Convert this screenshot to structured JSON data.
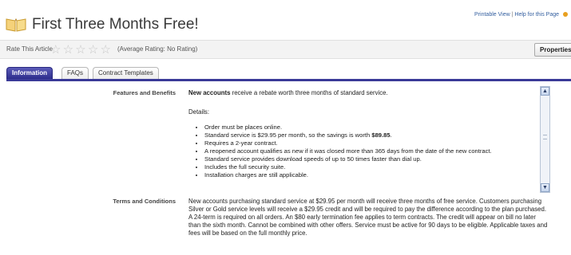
{
  "page": {
    "title": "First Three Months Free!",
    "links": {
      "printable": "Printable View",
      "separator": "|",
      "help": "Help for this Page"
    }
  },
  "rating": {
    "label": "Rate This Article",
    "stars": [
      "☆",
      "☆",
      "☆",
      "☆",
      "☆"
    ],
    "average_text": "(Average Rating: No Rating)",
    "properties_button": "Properties"
  },
  "tabs": [
    {
      "label": "Information",
      "active": true
    },
    {
      "label": "FAQs",
      "active": false
    },
    {
      "label": "Contract Templates",
      "active": false
    }
  ],
  "sections": {
    "features": {
      "label": "Features and Benefits",
      "intro_bold": "New accounts",
      "intro_rest": " receive a rebate worth three months of standard service.",
      "details_label": "Details:",
      "bullets": [
        "Order must be places online.",
        "Standard service is $29.95 per month, so the savings is worth ",
        "Requires a 2-year contract.",
        "A reopened account qualifies as new if it was closed more than 365 days from the date of the new contract.",
        "Standard service provides download speeds of up to 50 times faster than dial up.",
        "Includes the full security suite.",
        "Installation charges are still applicable."
      ],
      "savings_bold": "$89.85",
      "savings_end": "."
    },
    "terms": {
      "label": "Terms and Conditions",
      "text": "New accounts purchasing standard service at $29.95 per month will receive three months of free service. Customers purchasing Silver or Gold service levels will receive a $29.95 credit and will be required to pay the difference according to the plan purchased. A 24-term is required on all orders. An $80 early termination fee applies to term contracts. The credit will appear on bill no later than the sixth month. Cannot be combined with other offers. Service must be active for 90 days to be eligible. Applicable taxes and fees will be based on the full monthly price."
    }
  },
  "colors": {
    "tab_active": "#2d2d8c",
    "link": "#3560a0",
    "accent_dot": "#e8a020"
  }
}
